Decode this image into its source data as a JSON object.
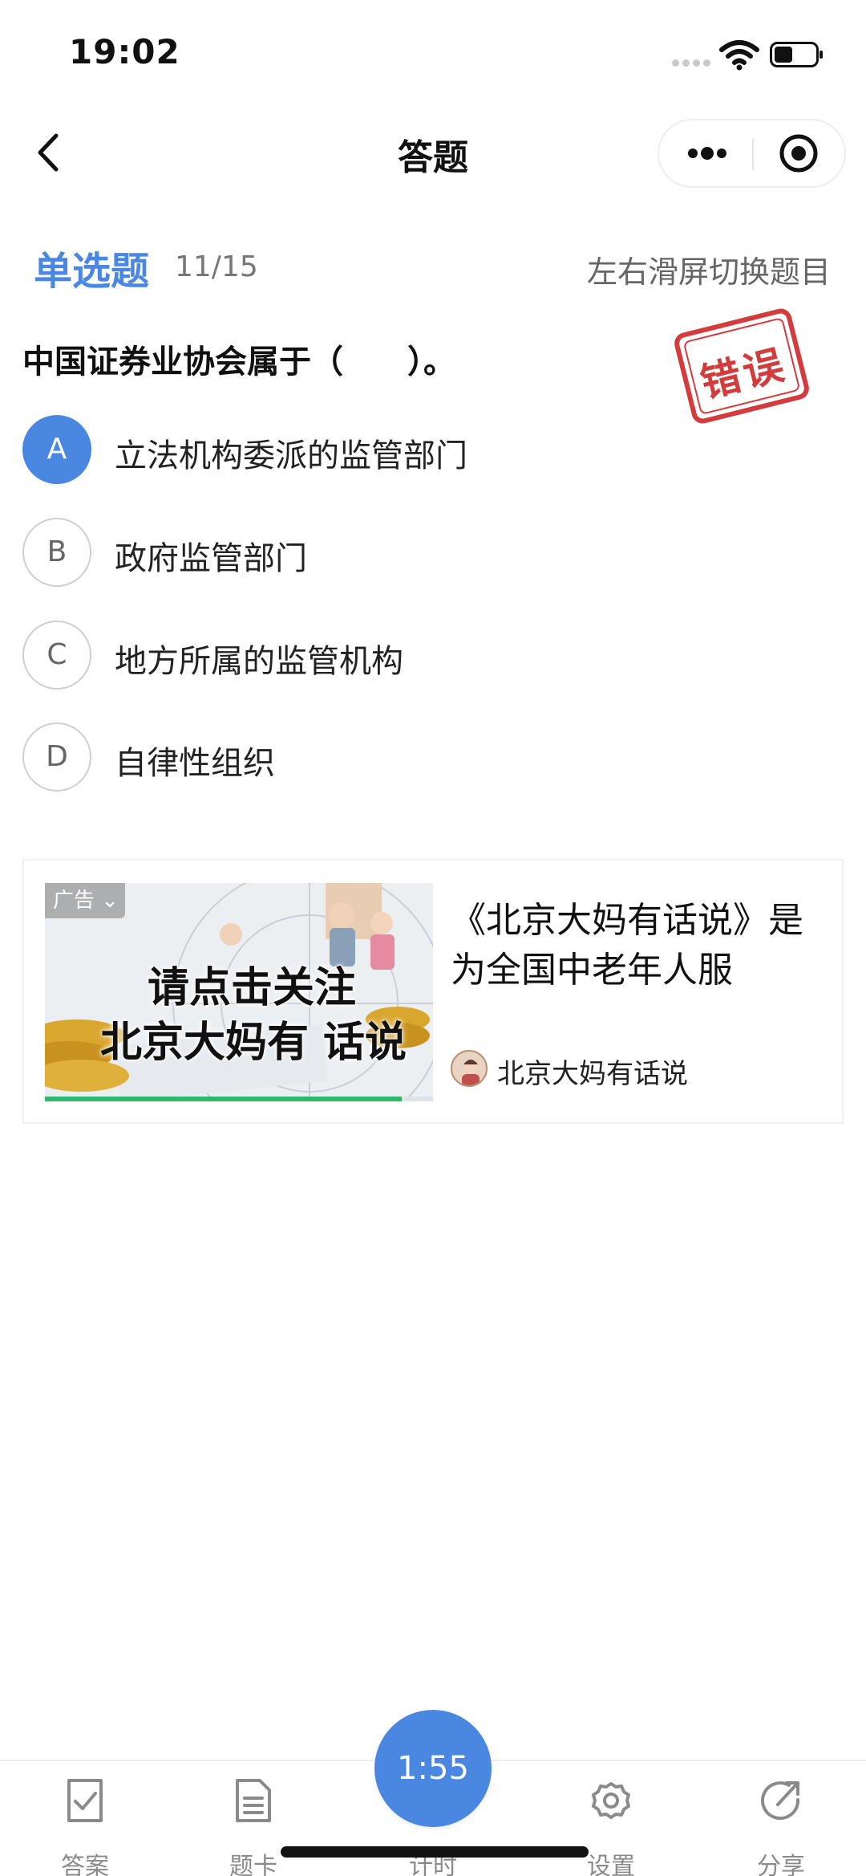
{
  "status_bar": {
    "time": "19:02"
  },
  "nav": {
    "title": "答题"
  },
  "question": {
    "type": "单选题",
    "progress": "11/15",
    "swipe_hint": "左右滑屏切换题目",
    "text": "中国证券业协会属于（　　）。",
    "stamp": "错误",
    "options": [
      {
        "letter": "A",
        "text": "立法机构委派的监管部门",
        "selected": true
      },
      {
        "letter": "B",
        "text": "政府监管部门",
        "selected": false
      },
      {
        "letter": "C",
        "text": "地方所属的监管机构",
        "selected": false
      },
      {
        "letter": "D",
        "text": "自律性组织",
        "selected": false
      }
    ]
  },
  "ad": {
    "badge": "广告",
    "image_line1": "请点击关注",
    "image_line2": "北京大妈有 话说",
    "title": "《北京大妈有话说》是为全国中老年人服",
    "source": "北京大妈有话说",
    "video_progress": 0.92
  },
  "tabs": {
    "answer": "答案",
    "card": "题卡",
    "timer_label": "计时",
    "settings": "设置",
    "share": "分享",
    "timer_value": "1:55"
  },
  "colors": {
    "accent": "#4a87e0",
    "stamp": "#d33c3c",
    "muted": "#8a8a8a"
  },
  "icons": {
    "back": "chevron-left-icon",
    "more": "more-dots-icon",
    "close": "target-circle-icon",
    "answer": "check-doc-icon",
    "card": "list-doc-icon",
    "settings": "gear-icon",
    "share": "share-arrow-icon"
  }
}
